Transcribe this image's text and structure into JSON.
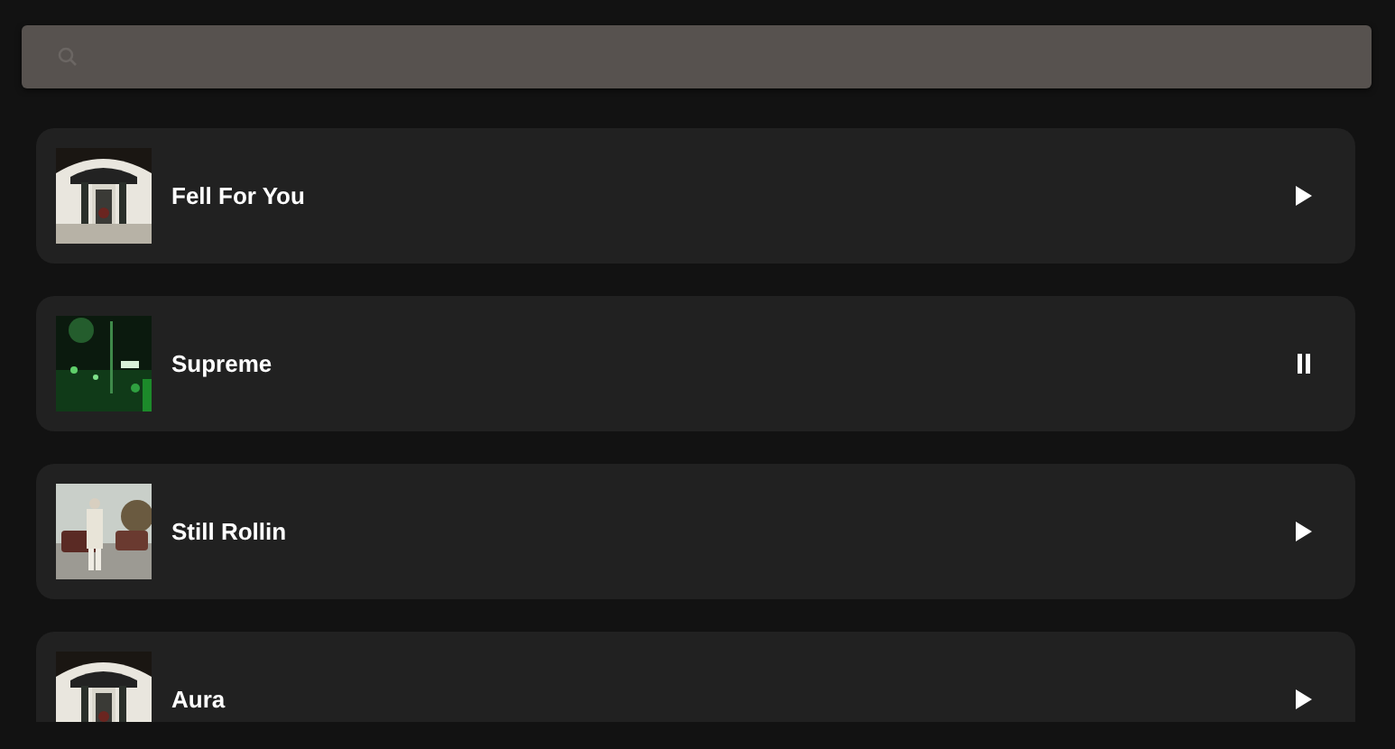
{
  "search": {
    "kind": "search"
  },
  "tracks": [
    {
      "title": "Fell For You",
      "playing": false
    },
    {
      "title": "Supreme",
      "playing": true
    },
    {
      "title": "Still Rollin",
      "playing": false
    },
    {
      "title": "Aura",
      "playing": false
    }
  ]
}
